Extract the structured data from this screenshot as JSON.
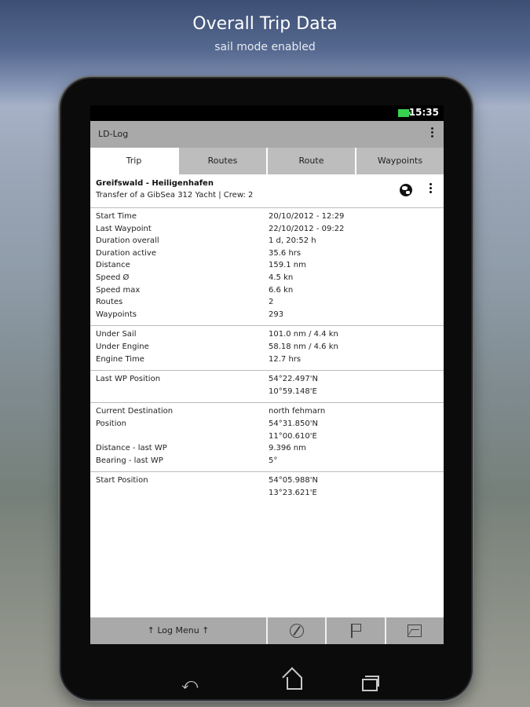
{
  "hero": {
    "title": "Overall Trip Data",
    "subtitle": "sail mode enabled"
  },
  "status": {
    "time": "15:35",
    "icon": "battery-icon"
  },
  "app": {
    "title": "LD-Log"
  },
  "tabs": [
    {
      "label": "Trip",
      "active": true
    },
    {
      "label": "Routes",
      "active": false
    },
    {
      "label": "Route",
      "active": false
    },
    {
      "label": "Waypoints",
      "active": false
    }
  ],
  "trip": {
    "name": "Greifswald - Heiligenhafen",
    "description": "Transfer of a GibSea 312 Yacht | Crew: 2"
  },
  "sections": [
    {
      "rows": [
        {
          "key": "Start Time",
          "value": "20/10/2012 - 12:29"
        },
        {
          "key": "Last Waypoint",
          "value": "22/10/2012 - 09:22"
        },
        {
          "key": "Duration overall",
          "value": "1 d, 20:52 h"
        },
        {
          "key": "Duration active",
          "value": "35.6 hrs"
        },
        {
          "key": "Distance",
          "value": "159.1 nm"
        },
        {
          "key": "Speed Ø",
          "value": "4.5 kn"
        },
        {
          "key": "Speed max",
          "value": "6.6 kn"
        },
        {
          "key": "Routes",
          "value": "2"
        },
        {
          "key": "Waypoints",
          "value": "293"
        }
      ]
    },
    {
      "rows": [
        {
          "key": "Under Sail",
          "value": "101.0 nm / 4.4 kn"
        },
        {
          "key": "Under Engine",
          "value": "58.18 nm / 4.6 kn"
        },
        {
          "key": "Engine Time",
          "value": "12.7 hrs"
        }
      ]
    },
    {
      "rows": [
        {
          "key": "Last WP Position",
          "value": "54°22.497'N"
        },
        {
          "key": "",
          "value": "10°59.148'E"
        }
      ]
    },
    {
      "rows": [
        {
          "key": "Current Destination",
          "value": "north fehmarn"
        },
        {
          "key": "Position",
          "value": "54°31.850'N"
        },
        {
          "key": "",
          "value": "11°00.610'E"
        },
        {
          "key": "Distance - last WP",
          "value": "9.396 nm"
        },
        {
          "key": "Bearing - last WP",
          "value": "5°"
        }
      ]
    },
    {
      "rows": [
        {
          "key": "Start Position",
          "value": "54°05.988'N"
        },
        {
          "key": "",
          "value": "13°23.621'E"
        }
      ]
    }
  ],
  "bottombar": {
    "log_menu": "↑     Log Menu     ↑",
    "icons": [
      "compass-icon",
      "flag-icon",
      "image-icon"
    ]
  },
  "navbar": {
    "back": "⤺",
    "icons": [
      "back-icon",
      "home-icon",
      "recents-icon"
    ]
  }
}
